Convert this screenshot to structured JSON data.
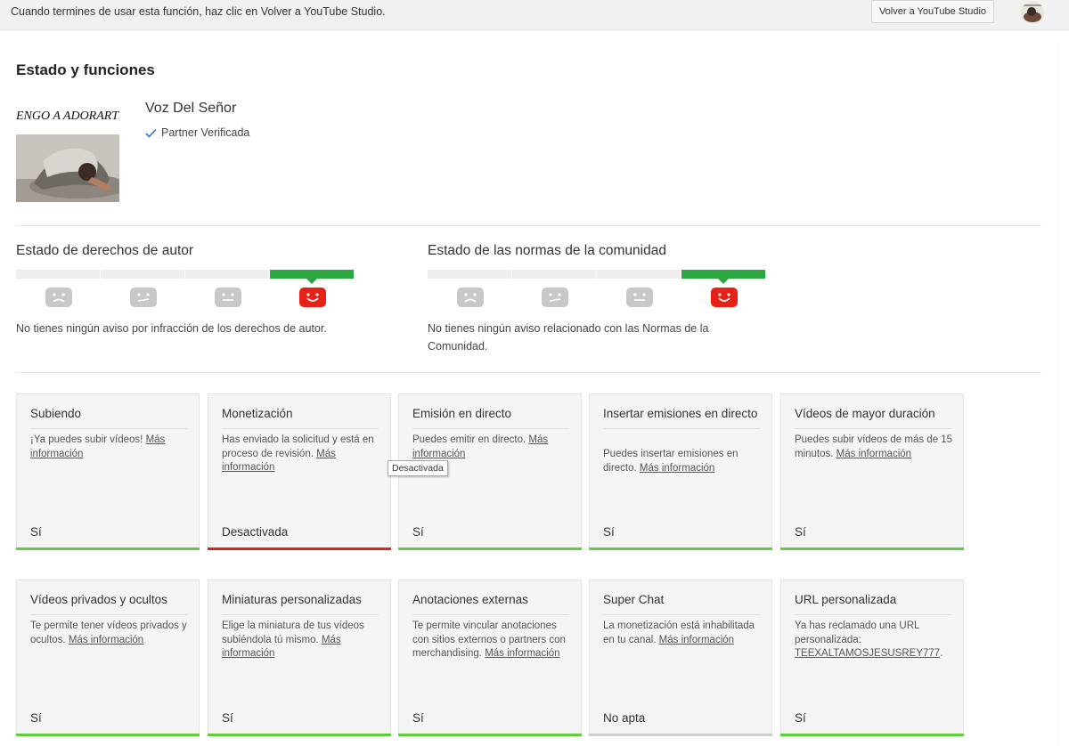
{
  "topbar": {
    "notice": "Cuando termines de usar esta función, haz clic en Volver a YouTube Studio.",
    "back_button": "Volver a YouTube Studio"
  },
  "page": {
    "title": "Estado y funciones"
  },
  "channel": {
    "name": "Voz Del Señor",
    "verified": "Partner Verificada",
    "thumbnail_text": "ENGO A ADORARTE"
  },
  "copyright": {
    "title": "Estado de derechos de autor",
    "status": "No tienes ningún aviso por infracción de los derechos de autor."
  },
  "community": {
    "title": "Estado de las normas de la comunidad",
    "status": "No tienes ningún aviso relacionado con las Normas de la Comunidad."
  },
  "features": [
    {
      "title": "Subiendo",
      "desc": "¡Ya puedes subir vídeos!",
      "link": "Más información",
      "status": "Sí",
      "bar": "green"
    },
    {
      "title": "Monetización",
      "desc": "Has enviado la solicitud y está en proceso de revisión.",
      "link": "Más información",
      "status": "Desactivada",
      "bar": "red"
    },
    {
      "title": "Emisión en directo",
      "desc": "Puedes emitir en directo.",
      "link": "Más información",
      "status": "Sí",
      "bar": "green"
    },
    {
      "title": "Insertar emisiones en directo",
      "desc": "Puedes insertar emisiones en directo.",
      "link": "Más información",
      "status": "Sí",
      "bar": "green"
    },
    {
      "title": "Vídeos de mayor duración",
      "desc": "Puedes subir vídeos de más de 15 minutos.",
      "link": "Más información",
      "status": "Sí",
      "bar": "green"
    },
    {
      "title": "Vídeos privados y ocultos",
      "desc": "Te permite tener vídeos privados y ocultos.",
      "link": "Más información",
      "status": "Sí",
      "bar": "green"
    },
    {
      "title": "Miniaturas personalizadas",
      "desc": "Elige la miniatura de tus vídeos subiéndola tú mismo.",
      "link": "Más información",
      "status": "Sí",
      "bar": "green"
    },
    {
      "title": "Anotaciones externas",
      "desc": "Te permite vincular anotaciones con sitios externos o partners con merchandising.",
      "link": "Más información",
      "status": "Sí",
      "bar": "green"
    },
    {
      "title": "Super Chat",
      "desc": "La monetización está inhabilitada en tu canal.",
      "link": "Más información",
      "status": "No apta",
      "bar": "gray"
    },
    {
      "title": "URL personalizada",
      "desc": "Ya has reclamado una URL personalizada:",
      "link": "TEEXALTAMOSJESUSREY777",
      "suffix": ".",
      "status": "Sí",
      "bar": "green"
    }
  ],
  "tooltip": "Desactivada",
  "colors": {
    "green": "#5fce3f",
    "red": "#e62117",
    "gray": "#cfcfcf",
    "face_gray": "#c8c8c8",
    "face_red": "#e62117"
  }
}
